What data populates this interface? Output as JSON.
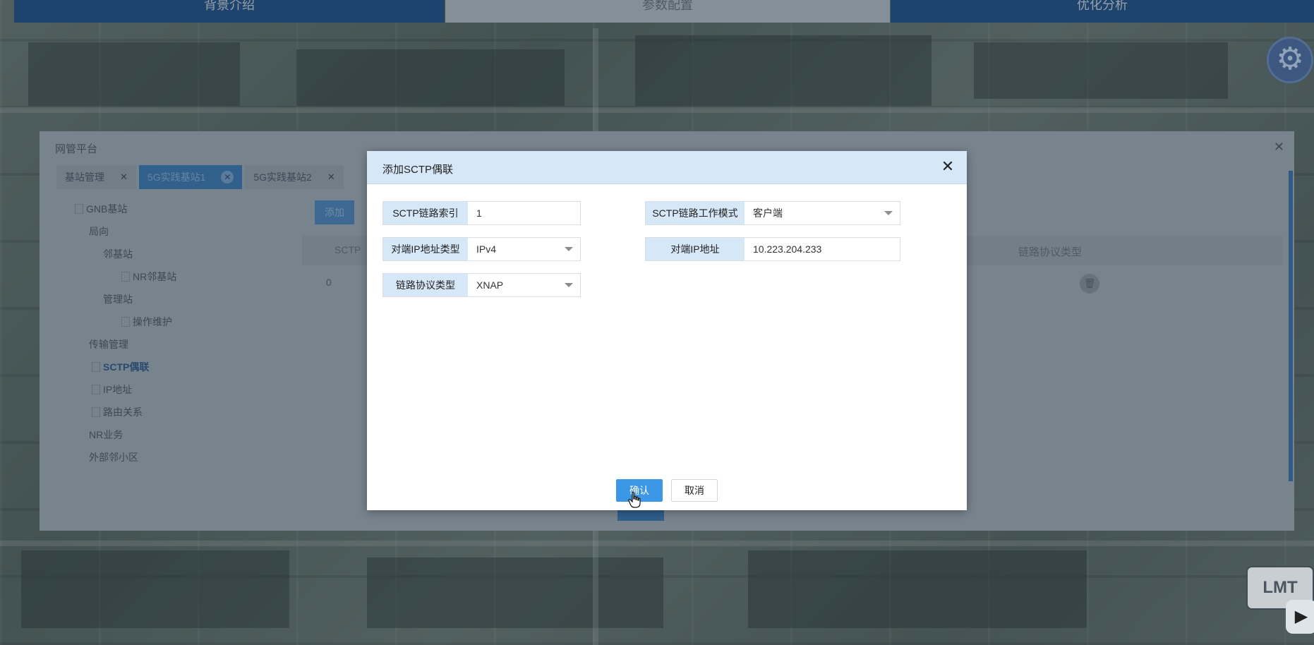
{
  "top_nav": {
    "tabs": [
      "背景介绍",
      "参数配置",
      "优化分析"
    ]
  },
  "platform": {
    "title": "网管平台",
    "tabs": [
      {
        "label": "基站管理",
        "active": false
      },
      {
        "label": "5G实践基站1",
        "active": true
      },
      {
        "label": "5G实践基站2",
        "active": false
      }
    ],
    "tree": {
      "gnb": "GNB基站",
      "local": "局向",
      "neighbor": "邻基站",
      "nr_neighbor": "NR邻基站",
      "mgmt_station": "管理站",
      "ops": "操作维护",
      "transport": "传输管理",
      "sctp": "SCTP偶联",
      "ip": "IP地址",
      "route": "路由关系",
      "nr_service": "NR业务",
      "ext_cell": "外部邻小区"
    },
    "add_button": "添加",
    "table": {
      "col_first": "SCTP",
      "col_protocol": "链路协议类型",
      "row_value": "0"
    },
    "lmt": "LMT"
  },
  "dialog": {
    "title": "添加SCTP偶联",
    "fields": {
      "sctp_index": {
        "label": "SCTP链路索引",
        "value": "1"
      },
      "sctp_mode": {
        "label": "SCTP链路工作模式",
        "value": "客户端"
      },
      "peer_ip_type": {
        "label": "对端IP地址类型",
        "value": "IPv4"
      },
      "peer_ip": {
        "label": "对端IP地址",
        "value": "10.223.204.233"
      },
      "protocol": {
        "label": "链路协议类型",
        "value": "XNAP"
      }
    },
    "confirm": "确认",
    "cancel": "取消"
  },
  "colors": {
    "accent": "#3c98e6",
    "header_bg": "#d6e7f7",
    "nav_blue": "#1f4f86"
  }
}
